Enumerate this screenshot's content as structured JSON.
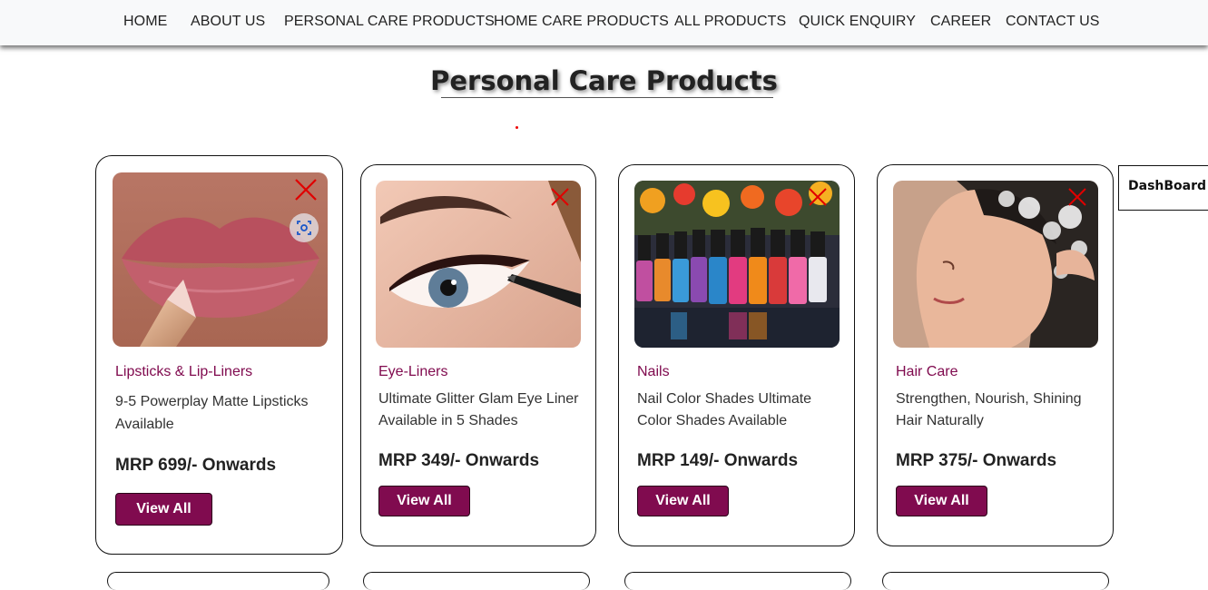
{
  "nav": {
    "items": [
      "HOME",
      "ABOUT US",
      "PERSONAL CARE PRODUCTS",
      "HOME CARE PRODUCTS",
      "ALL PRODUCTS",
      "QUICK ENQUIRY",
      "CAREER",
      "CONTACT US"
    ]
  },
  "page": {
    "title": "Personal Care Products"
  },
  "products": [
    {
      "category": "Lipsticks & Lip-Liners",
      "description": "9-5 Powerplay Matte Lipsticks Available",
      "price": "MRP 699/- Onwards",
      "button": "View All",
      "image_icon": "lips-image"
    },
    {
      "category": "Eye-Liners",
      "description": "Ultimate Glitter Glam Eye Liner Available in 5 Shades",
      "price": "MRP 349/- Onwards",
      "button": "View All",
      "image_icon": "eyeliner-image"
    },
    {
      "category": "Nails",
      "description": "Nail Color Shades Ultimate Color Shades Available",
      "price": "MRP 149/- Onwards",
      "button": "View All",
      "image_icon": "nail-polish-image"
    },
    {
      "category": "Hair Care",
      "description": "Strengthen, Nourish, Shining Hair Naturally",
      "price": "MRP 375/- Onwards",
      "button": "View All",
      "image_icon": "hair-care-image"
    }
  ],
  "dashboard": {
    "label": "DashBoard"
  },
  "colors": {
    "accent": "#800b4f",
    "close": "#e00000",
    "nav_bg": "#f8f9fa"
  }
}
